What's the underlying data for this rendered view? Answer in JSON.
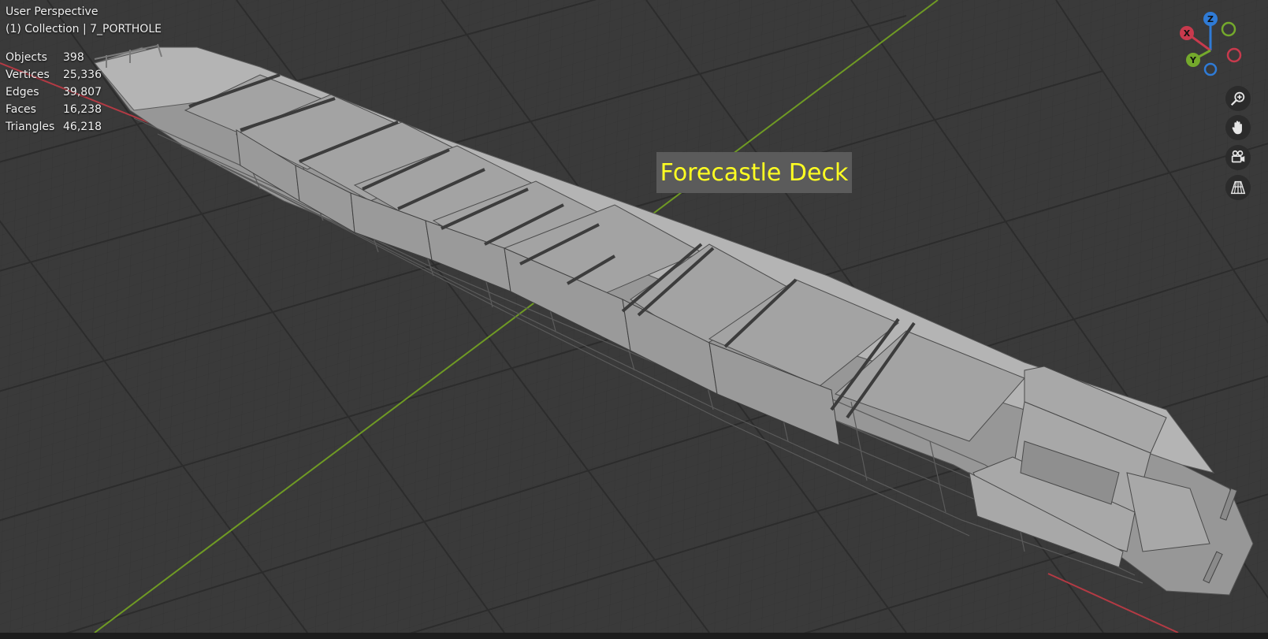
{
  "viewport": {
    "view_name": "User Perspective",
    "collection_line": "(1) Collection | 7_PORTHOLE",
    "annotation": "Forecastle Deck"
  },
  "stats": [
    {
      "label": "Objects",
      "value": "398"
    },
    {
      "label": "Vertices",
      "value": "25,336"
    },
    {
      "label": "Edges",
      "value": "39,807"
    },
    {
      "label": "Faces",
      "value": "16,238"
    },
    {
      "label": "Triangles",
      "value": "46,218"
    }
  ],
  "gizmo": {
    "x_label": "X",
    "y_label": "Y",
    "z_label": "Z",
    "x_color": "#c83a4d",
    "y_color": "#74a92c",
    "z_color": "#2f7bd6"
  },
  "nav_buttons": [
    {
      "name": "zoom",
      "icon": "magnifier-plus-icon"
    },
    {
      "name": "pan",
      "icon": "hand-icon"
    },
    {
      "name": "camera",
      "icon": "camera-icon"
    },
    {
      "name": "projection",
      "icon": "perspective-grid-icon"
    }
  ],
  "colors": {
    "background": "#3a3a3a",
    "grid": "#2e2e2e",
    "x_axis_line": "#b33a44",
    "y_axis_line": "#6f9a24",
    "annotation_text": "#ffff22",
    "model_grey": "#a9a9a9"
  }
}
